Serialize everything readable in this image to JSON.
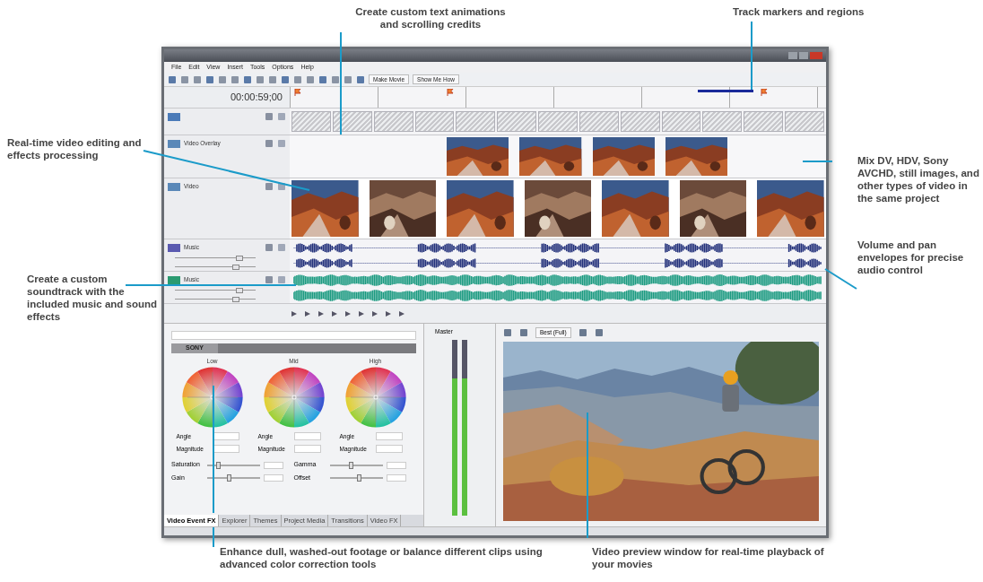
{
  "callouts": {
    "top": [
      {
        "text": "Create custom text animations and scrolling credits"
      },
      {
        "text": "Track markers and regions"
      }
    ],
    "left": [
      {
        "text": "Real-time video editing and effects processing"
      },
      {
        "text": "Create a custom soundtrack with the included music and sound effects"
      }
    ],
    "right": [
      {
        "text": "Mix DV, HDV, Sony AVCHD, still images, and other types of video in the same project"
      },
      {
        "text": "Volume and pan envelopes for precise audio control"
      }
    ],
    "bottom": [
      {
        "text": "Enhance dull, washed-out footage or balance different clips using advanced color correction tools"
      },
      {
        "text": "Video preview window for real-time playback of your movies"
      }
    ]
  },
  "window": {
    "menu": [
      "File",
      "Edit",
      "View",
      "Insert",
      "Tools",
      "Options",
      "Help"
    ],
    "toolbar_buttons": [
      "Make Movie",
      "Show Me How"
    ],
    "timecode": "00:00:59;00",
    "tracks": [
      {
        "kind": "text"
      },
      {
        "kind": "overlay",
        "name": "Video Overlay"
      },
      {
        "kind": "video",
        "name": "Video"
      },
      {
        "kind": "audio",
        "name": "Music",
        "color": "#22307a",
        "sliders": [
          {
            "level": 0.8
          },
          {
            "level": 0.75
          }
        ]
      },
      {
        "kind": "audio",
        "name": "Music",
        "color": "#1a9a80",
        "sliders": [
          {
            "level": 0.8
          },
          {
            "level": 0.75
          }
        ]
      }
    ],
    "color_corrector": {
      "brand": "SONY",
      "wheels": [
        {
          "label": "Low",
          "fields": [
            "Angle",
            "Magnitude"
          ]
        },
        {
          "label": "Mid",
          "fields": [
            "Angle",
            "Magnitude"
          ]
        },
        {
          "label": "High",
          "fields": [
            "Angle",
            "Magnitude"
          ]
        }
      ],
      "sliders": [
        {
          "label": "Saturation",
          "level": 0.2
        },
        {
          "label": "Gamma",
          "level": 0.4
        },
        {
          "label": "Gain",
          "level": 0.4
        },
        {
          "label": "Offset",
          "level": 0.55
        }
      ]
    },
    "tabs": [
      {
        "label": "Video Event FX",
        "selected": true
      },
      {
        "label": "Explorer",
        "selected": false
      },
      {
        "label": "Themes",
        "selected": false
      },
      {
        "label": "Project Media",
        "selected": false
      },
      {
        "label": "Transitions",
        "selected": false
      },
      {
        "label": "Video FX",
        "selected": false
      }
    ],
    "mixer": {
      "title": "Master",
      "meters": [
        {
          "level": 0.78
        },
        {
          "level": 0.78
        }
      ]
    },
    "preview": {
      "quality": "Best (Full)"
    }
  }
}
